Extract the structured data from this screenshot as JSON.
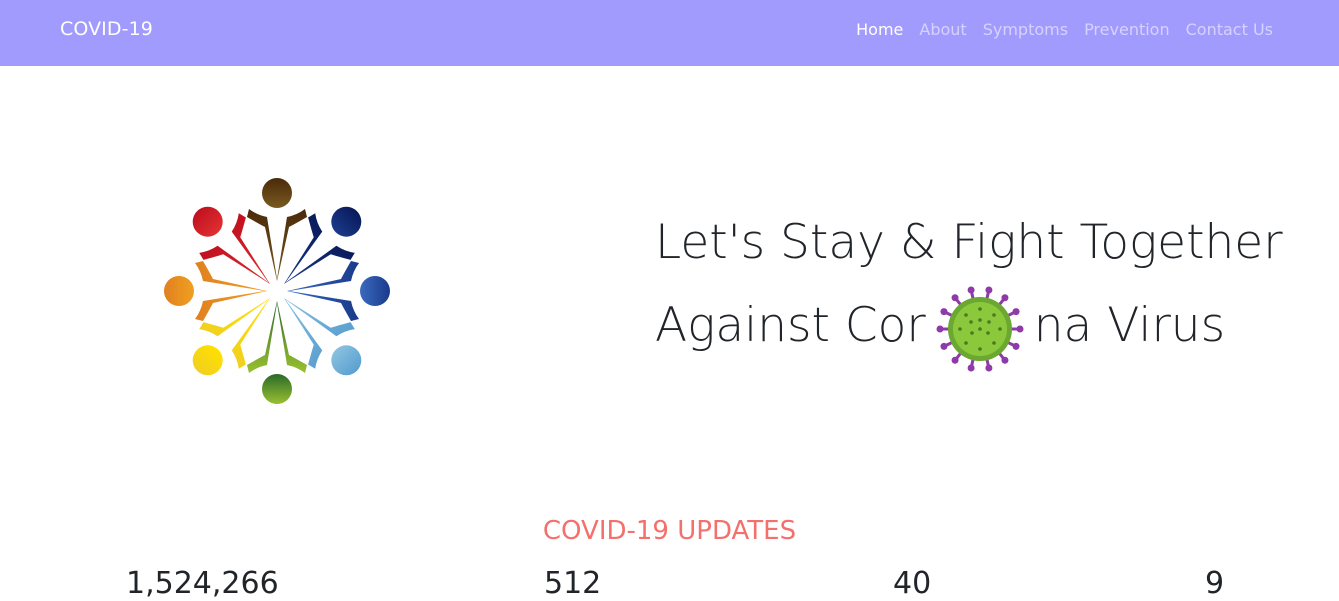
{
  "navbar": {
    "brand": "COVID-19",
    "links": [
      {
        "label": "Home",
        "active": true
      },
      {
        "label": "About",
        "active": false
      },
      {
        "label": "Symptoms",
        "active": false
      },
      {
        "label": "Prevention",
        "active": false
      },
      {
        "label": "Contact Us",
        "active": false
      }
    ],
    "background_color": "#a29bfe"
  },
  "hero": {
    "line1": "Let's Stay & Fight Together",
    "line2_before": "Against Cor",
    "line2_after": "na Virus",
    "logo_icon": "people-circle-logo-icon",
    "virus_icon": "coronavirus-icon"
  },
  "updates": {
    "title": "COVID-19 UPDATES",
    "title_color": "#f3706c",
    "stats": [
      "1,524,266",
      "512",
      "40",
      "9"
    ]
  }
}
